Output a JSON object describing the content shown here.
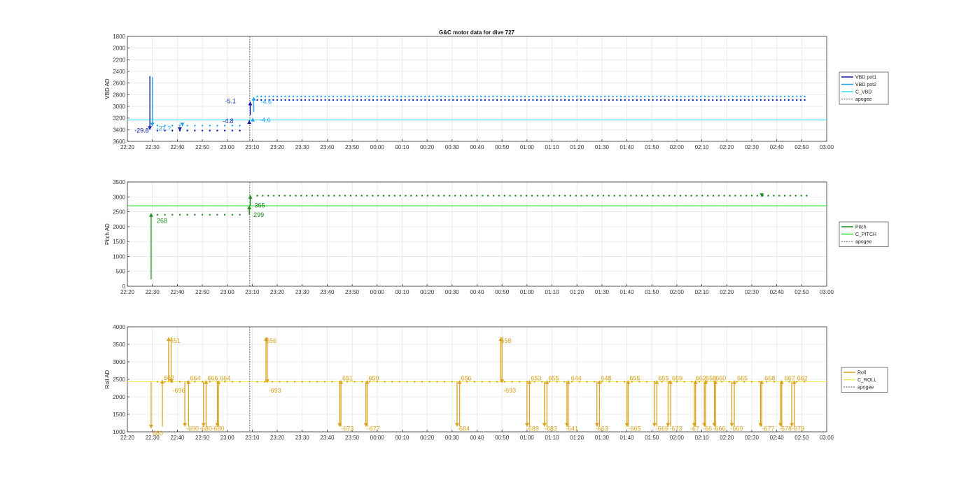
{
  "figure": {
    "title": "G&C motor data for dive 727"
  },
  "colors": {
    "vbd_pot1": "#0a1aa8",
    "vbd_pot2": "#1fa3e8",
    "c_vbd": "#36e1f0",
    "pitch": "#1a8c1a",
    "c_pitch": "#33e033",
    "roll": "#d9a21b",
    "c_roll": "#f2ea4a",
    "apogee": "#555555",
    "grid": "#e6e6e6",
    "axis": "#333333"
  },
  "time_ticks": [
    "22:20",
    "22:30",
    "22:40",
    "22:50",
    "23:00",
    "23:10",
    "23:20",
    "23:30",
    "23:40",
    "23:50",
    "00:00",
    "00:10",
    "00:20",
    "00:30",
    "00:40",
    "00:50",
    "01:00",
    "01:10",
    "01:20",
    "01:30",
    "01:40",
    "01:50",
    "02:00",
    "02:10",
    "02:20",
    "02:30",
    "02:40",
    "02:50",
    "03:00"
  ],
  "chart_data": [
    {
      "type": "line",
      "title": "G&C motor data for dive 727",
      "ylabel": "VBD AD",
      "ylim": [
        1800,
        3600
      ],
      "y_reversed": true,
      "yticks": [
        1800,
        2000,
        2200,
        2400,
        2600,
        2800,
        3000,
        3200,
        3400,
        3600
      ],
      "xlim_minutes": [
        0,
        280
      ],
      "apogee_minute": 49,
      "legend": [
        {
          "label": "VBD pot1",
          "color_key": "vbd_pot1",
          "dashed": false
        },
        {
          "label": "VBD pot2",
          "color_key": "vbd_pot2",
          "dashed": false
        },
        {
          "label": "C_VBD",
          "color_key": "c_vbd",
          "dashed": false
        },
        {
          "label": "apogee",
          "color_key": "apogee",
          "dashed": true
        }
      ],
      "reference_lines": [
        {
          "name": "C_VBD",
          "value": 3230,
          "color_key": "c_vbd"
        }
      ],
      "series": [
        {
          "name": "VBD pot1",
          "color_key": "vbd_pot1",
          "y_start_pre": 3415,
          "y_start_post": 2890,
          "dot_spacing_pre": 3,
          "dot_spacing_post": 1.6
        },
        {
          "name": "VBD pot2",
          "color_key": "vbd_pot2",
          "y_start_pre": 3330,
          "y_start_post": 2830,
          "dot_spacing_pre": 3,
          "dot_spacing_post": 1.6
        }
      ],
      "events": [
        {
          "t": 9,
          "from": 2480,
          "to": 3400,
          "color_key": "vbd_pot1",
          "label": "-29.8",
          "lx": -22,
          "ly": 4
        },
        {
          "t": 10,
          "from": 2500,
          "to": 3340,
          "color_key": "vbd_pot2",
          "label": "-27.?",
          "lx": 6,
          "ly": 6
        },
        {
          "t": 21,
          "from": 3410,
          "to": 3420,
          "color_key": "vbd_pot1",
          "label": "",
          "lx": 0,
          "ly": 0
        },
        {
          "t": 22,
          "from": 3320,
          "to": 3340,
          "color_key": "vbd_pot2",
          "label": "",
          "lx": 0,
          "ly": 0
        },
        {
          "t": 48.8,
          "from": 3290,
          "to": 3240,
          "color_key": "vbd_pot1",
          "label": "-4.8",
          "lx": -38,
          "ly": 4
        },
        {
          "t": 49.2,
          "from": 3150,
          "to": 2920,
          "color_key": "vbd_pot1",
          "label": "-5.1",
          "lx": -36,
          "ly": 2
        },
        {
          "t": 50.2,
          "from": 3260,
          "to": 3200,
          "color_key": "vbd_pot2",
          "label": "-4.6",
          "lx": 10,
          "ly": 6
        },
        {
          "t": 50.6,
          "from": 3100,
          "to": 2840,
          "color_key": "vbd_pot2",
          "label": "-4.6",
          "lx": 10,
          "ly": 10
        }
      ]
    },
    {
      "type": "line",
      "ylabel": "Pitch AD",
      "ylim": [
        0,
        3500
      ],
      "y_reversed": false,
      "yticks": [
        0,
        500,
        1000,
        1500,
        2000,
        2500,
        3000,
        3500
      ],
      "xlim_minutes": [
        0,
        280
      ],
      "apogee_minute": 49,
      "legend": [
        {
          "label": "Pitch",
          "color_key": "pitch",
          "dashed": false
        },
        {
          "label": "C_PITCH",
          "color_key": "c_pitch",
          "dashed": false
        },
        {
          "label": "apogee",
          "color_key": "apogee",
          "dashed": true
        }
      ],
      "reference_lines": [
        {
          "name": "C_PITCH",
          "value": 2700,
          "color_key": "c_pitch"
        }
      ],
      "series": [
        {
          "name": "Pitch",
          "color_key": "pitch",
          "y_start_pre": 2400,
          "y_start_post": 3040,
          "dot_spacing_pre": 3,
          "dot_spacing_post": 2.2
        }
      ],
      "events": [
        {
          "t": 9.5,
          "from": 230,
          "to": 2450,
          "color_key": "pitch",
          "label": "268",
          "lx": 8,
          "ly": 14
        },
        {
          "t": 48.8,
          "from": 2400,
          "to": 2700,
          "color_key": "pitch",
          "label": "299",
          "lx": 6,
          "ly": 16
        },
        {
          "t": 49.2,
          "from": 2700,
          "to": 3060,
          "color_key": "pitch",
          "label": "365",
          "lx": 6,
          "ly": 18
        },
        {
          "t": 254,
          "from": 3060,
          "to": 3000,
          "color_key": "pitch",
          "label": "",
          "lx": 0,
          "ly": 0
        }
      ]
    },
    {
      "type": "line",
      "ylabel": "Roll AD",
      "ylim": [
        1000,
        4000
      ],
      "y_reversed": false,
      "yticks": [
        1000,
        1500,
        2000,
        2500,
        3000,
        3500,
        4000
      ],
      "xlim_minutes": [
        0,
        280
      ],
      "apogee_minute": 49,
      "legend": [
        {
          "label": "Roll",
          "color_key": "roll",
          "dashed": false
        },
        {
          "label": "C_ROLL",
          "color_key": "c_roll",
          "dashed": false
        },
        {
          "label": "apogee",
          "color_key": "apogee",
          "dashed": true
        }
      ],
      "reference_lines": [
        {
          "name": "C_ROLL",
          "value": 2430,
          "color_key": "c_roll"
        }
      ],
      "series": [
        {
          "name": "Roll",
          "color_key": "roll",
          "y_start_pre": 2430,
          "y_start_post": 2430,
          "dot_spacing_pre": 3,
          "dot_spacing_post": 3
        }
      ],
      "events": [
        {
          "t": 9.5,
          "from": 2430,
          "to": 1100,
          "color_key": "roll",
          "label": "680",
          "lx": 2,
          "ly": 10
        },
        {
          "t": 14,
          "from": 1150,
          "to": 2480,
          "color_key": "roll",
          "label": "662",
          "lx": 2,
          "ly": 0
        },
        {
          "t": 16.5,
          "from": 2430,
          "to": 3700,
          "color_key": "roll",
          "label": "651",
          "lx": 2,
          "ly": 8
        },
        {
          "t": 17.5,
          "from": 3700,
          "to": 2400,
          "color_key": "roll",
          "label": "-696",
          "lx": 2,
          "ly": 14
        },
        {
          "t": 23,
          "from": 2430,
          "to": 1150,
          "color_key": "roll",
          "label": "-690",
          "lx": 2,
          "ly": 6
        },
        {
          "t": 24.5,
          "from": 1150,
          "to": 2470,
          "color_key": "roll",
          "label": "664",
          "lx": 2,
          "ly": 0
        },
        {
          "t": 30.5,
          "from": 2430,
          "to": 1150,
          "color_key": "roll",
          "label": "-680",
          "lx": -6,
          "ly": 6
        },
        {
          "t": 31.5,
          "from": 1150,
          "to": 2470,
          "color_key": "roll",
          "label": "666",
          "lx": 2,
          "ly": 0
        },
        {
          "t": 36,
          "from": 2430,
          "to": 1150,
          "color_key": "roll",
          "label": "-680",
          "lx": -8,
          "ly": 6
        },
        {
          "t": 36.5,
          "from": 1150,
          "to": 2470,
          "color_key": "roll",
          "label": "664",
          "lx": 2,
          "ly": 0
        },
        {
          "t": 55.5,
          "from": 2430,
          "to": 3700,
          "color_key": "roll",
          "label": "656",
          "lx": 0,
          "ly": 8
        },
        {
          "t": 56,
          "from": 3700,
          "to": 2400,
          "color_key": "roll",
          "label": "-693",
          "lx": 2,
          "ly": 14
        },
        {
          "t": 85,
          "from": 2430,
          "to": 1150,
          "color_key": "roll",
          "label": "-673",
          "lx": 2,
          "ly": 6
        },
        {
          "t": 85.5,
          "from": 1150,
          "to": 2470,
          "color_key": "roll",
          "label": "651",
          "lx": 2,
          "ly": 0
        },
        {
          "t": 95.5,
          "from": 2430,
          "to": 1150,
          "color_key": "roll",
          "label": "-677",
          "lx": 2,
          "ly": 6
        },
        {
          "t": 96,
          "from": 1150,
          "to": 2470,
          "color_key": "roll",
          "label": "659",
          "lx": 2,
          "ly": 0
        },
        {
          "t": 132,
          "from": 2430,
          "to": 1150,
          "color_key": "roll",
          "label": "-684",
          "lx": 0,
          "ly": 6
        },
        {
          "t": 133,
          "from": 1150,
          "to": 2470,
          "color_key": "roll",
          "label": "656",
          "lx": 2,
          "ly": 0
        },
        {
          "t": 149.5,
          "from": 2430,
          "to": 3700,
          "color_key": "roll",
          "label": "658",
          "lx": 0,
          "ly": 8
        },
        {
          "t": 150,
          "from": 3700,
          "to": 2400,
          "color_key": "roll",
          "label": "-693",
          "lx": 2,
          "ly": 14
        },
        {
          "t": 160,
          "from": 2430,
          "to": 1150,
          "color_key": "roll",
          "label": "-689",
          "lx": -1,
          "ly": 6
        },
        {
          "t": 161,
          "from": 1150,
          "to": 2470,
          "color_key": "roll",
          "label": "653",
          "lx": 2,
          "ly": 0
        },
        {
          "t": 167,
          "from": 2430,
          "to": 1150,
          "color_key": "roll",
          "label": "-683",
          "lx": 0,
          "ly": 6
        },
        {
          "t": 168,
          "from": 1150,
          "to": 2470,
          "color_key": "roll",
          "label": "655",
          "lx": 2,
          "ly": 0
        },
        {
          "t": 176,
          "from": 2430,
          "to": 1150,
          "color_key": "roll",
          "label": "-641",
          "lx": -2,
          "ly": 6
        },
        {
          "t": 176.5,
          "from": 1150,
          "to": 2470,
          "color_key": "roll",
          "label": "644",
          "lx": 4,
          "ly": 0
        },
        {
          "t": 188,
          "from": 2430,
          "to": 1150,
          "color_key": "roll",
          "label": "-663",
          "lx": -2,
          "ly": 6
        },
        {
          "t": 189,
          "from": 1150,
          "to": 2470,
          "color_key": "roll",
          "label": "648",
          "lx": 2,
          "ly": 0
        },
        {
          "t": 200,
          "from": 2430,
          "to": 1150,
          "color_key": "roll",
          "label": "-665",
          "lx": 2,
          "ly": 6
        },
        {
          "t": 200.5,
          "from": 1150,
          "to": 2470,
          "color_key": "roll",
          "label": "655",
          "lx": 2,
          "ly": 0
        },
        {
          "t": 211,
          "from": 2430,
          "to": 1150,
          "color_key": "roll",
          "label": "-669",
          "lx": 2,
          "ly": 6
        },
        {
          "t": 212,
          "from": 1150,
          "to": 2470,
          "color_key": "roll",
          "label": "655",
          "lx": 2,
          "ly": 0
        },
        {
          "t": 216.5,
          "from": 2430,
          "to": 1150,
          "color_key": "roll",
          "label": "-673",
          "lx": 2,
          "ly": 6
        },
        {
          "t": 217.5,
          "from": 1150,
          "to": 2470,
          "color_key": "roll",
          "label": "659",
          "lx": 2,
          "ly": 0
        },
        {
          "t": 227,
          "from": 2430,
          "to": 1150,
          "color_key": "roll",
          "label": "-67",
          "lx": -6,
          "ly": 6
        },
        {
          "t": 227.5,
          "from": 1150,
          "to": 2470,
          "color_key": "roll",
          "label": "662",
          "lx": 0,
          "ly": 0
        },
        {
          "t": 231,
          "from": 2430,
          "to": 1150,
          "color_key": "roll",
          "label": "-66",
          "lx": -2,
          "ly": 6
        },
        {
          "t": 231.5,
          "from": 1150,
          "to": 2470,
          "color_key": "roll",
          "label": "658",
          "lx": 0,
          "ly": 0
        },
        {
          "t": 235,
          "from": 2430,
          "to": 1150,
          "color_key": "roll",
          "label": "-666",
          "lx": -2,
          "ly": 6
        },
        {
          "t": 235.5,
          "from": 1150,
          "to": 2470,
          "color_key": "roll",
          "label": "660",
          "lx": 0,
          "ly": 0
        },
        {
          "t": 242,
          "from": 2430,
          "to": 1150,
          "color_key": "roll",
          "label": "-669",
          "lx": -2,
          "ly": 6
        },
        {
          "t": 243,
          "from": 1150,
          "to": 2470,
          "color_key": "roll",
          "label": "665",
          "lx": 4,
          "ly": 0
        },
        {
          "t": 253.5,
          "from": 2430,
          "to": 1150,
          "color_key": "roll",
          "label": "-677",
          "lx": 2,
          "ly": 6
        },
        {
          "t": 254,
          "from": 1150,
          "to": 2470,
          "color_key": "roll",
          "label": "668",
          "lx": 4,
          "ly": 0
        },
        {
          "t": 261.5,
          "from": 2430,
          "to": 1150,
          "color_key": "roll",
          "label": "-678",
          "lx": -2,
          "ly": 6
        },
        {
          "t": 262,
          "from": 1150,
          "to": 2470,
          "color_key": "roll",
          "label": "667",
          "lx": 4,
          "ly": 0
        },
        {
          "t": 266,
          "from": 2430,
          "to": 1150,
          "color_key": "roll",
          "label": "-679",
          "lx": 0,
          "ly": 6
        },
        {
          "t": 267,
          "from": 1150,
          "to": 2470,
          "color_key": "roll",
          "label": "662",
          "lx": 4,
          "ly": 0
        }
      ]
    }
  ]
}
